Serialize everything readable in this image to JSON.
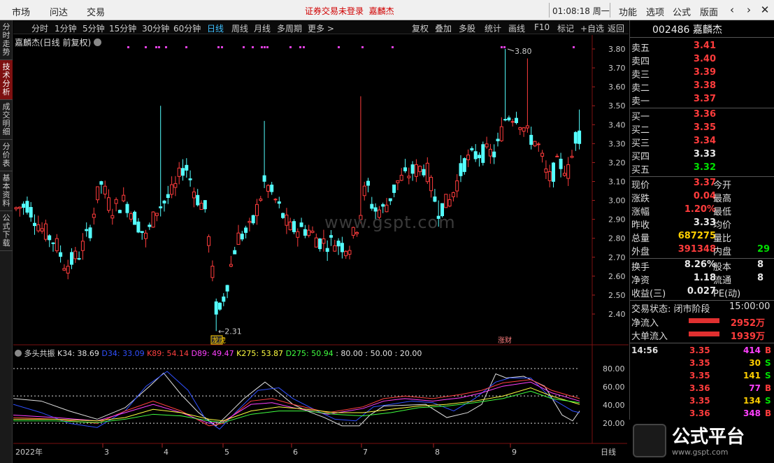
{
  "menu": {
    "market": "市场",
    "ask": "问达",
    "trade": "交易",
    "warning": "证券交易未登录",
    "stock": "嘉麟杰",
    "clock": "01:08:18 周一",
    "func": "功能",
    "option": "选项",
    "formula": "公式",
    "layout": "版面"
  },
  "left_tabs": [
    "分时走势",
    "技术分析",
    "成交明细",
    "分价表",
    "基本资料",
    "公式下载"
  ],
  "periods": [
    "分时",
    "1分钟",
    "5分钟",
    "15分钟",
    "30分钟",
    "60分钟",
    "日线",
    "周线",
    "月线",
    "多周期",
    "更多 >"
  ],
  "tools": [
    "复权",
    "叠加",
    "多股",
    "统计",
    "画线",
    "F10",
    "标记",
    "+自选",
    "返回"
  ],
  "chart_title": "嘉麟杰(日线 前复权)",
  "watermark": "www.gspt.com",
  "price_axis": [
    "3.80",
    "3.70",
    "3.60",
    "3.50",
    "3.40",
    "3.30",
    "3.20",
    "3.10",
    "3.00",
    "2.90",
    "2.80",
    "2.70",
    "2.60",
    "2.50",
    "2.40"
  ],
  "ind_axis": [
    "80.00",
    "60.00",
    "40.00",
    "20.00"
  ],
  "x_labels": [
    "2022年",
    "3",
    "4",
    "5",
    "6",
    "7",
    "8",
    "9"
  ],
  "period_badge": "日线",
  "annotations": {
    "high": "3.80",
    "low": "2.31",
    "tag1": "龙虎",
    "tag2": "涨财"
  },
  "indicator": {
    "name": "多头共振",
    "items": [
      "K34: 38.69",
      "D34: 33.09",
      "K89: 54.14",
      "D89: 49.47",
      "K275: 53.87",
      "D275: 50.94",
      ": 80.00",
      ": 50.00",
      ": 20.00"
    ],
    "colors": [
      "#e0e0e0",
      "#3050ff",
      "#ff4040",
      "#ff40ff",
      "#ffff40",
      "#40ff40",
      "#e0e0e0",
      "#e0e0e0",
      "#e0e0e0"
    ]
  },
  "chart_data": {
    "type": "candlestick",
    "symbol": "002486",
    "name": "嘉麟杰",
    "high": 3.8,
    "low": 2.31,
    "ylim": [
      2.31,
      3.82
    ],
    "ind_ylim": [
      0,
      100
    ]
  },
  "quote": {
    "code": "002486",
    "name": "嘉麟杰",
    "asks": [
      {
        "l": "卖五",
        "v": "3.41"
      },
      {
        "l": "卖四",
        "v": "3.40"
      },
      {
        "l": "卖三",
        "v": "3.39"
      },
      {
        "l": "卖二",
        "v": "3.38"
      },
      {
        "l": "卖一",
        "v": "3.37"
      }
    ],
    "bids": [
      {
        "l": "买一",
        "v": "3.36"
      },
      {
        "l": "买二",
        "v": "3.35"
      },
      {
        "l": "买三",
        "v": "3.34"
      },
      {
        "l": "买四",
        "v": "3.33"
      },
      {
        "l": "买五",
        "v": "3.32"
      }
    ],
    "stats": [
      {
        "l": "现价",
        "v": "3.37",
        "l2": "今开",
        "v2": ""
      },
      {
        "l": "涨跌",
        "v": "0.04",
        "l2": "最高",
        "v2": ""
      },
      {
        "l": "涨幅",
        "v": "1.20%",
        "l2": "最低",
        "v2": ""
      },
      {
        "l": "昨收",
        "v": "3.33",
        "l2": "均价",
        "v2": ""
      },
      {
        "l": "总量",
        "v": "687275",
        "l2": "量比",
        "v2": ""
      },
      {
        "l": "外盘",
        "v": "391348",
        "l2": "内盘",
        "v2": "29"
      }
    ],
    "stats2": [
      {
        "l": "换手",
        "v": "8.26%",
        "l2": "股本",
        "v2": "8"
      },
      {
        "l": "净资",
        "v": "1.18",
        "l2": "流通",
        "v2": "8"
      },
      {
        "l": "收益(三)",
        "v": "0.027",
        "l2": "PE(动)",
        "v2": ""
      }
    ],
    "status_label": "交易状态: 闭市阶段",
    "status_time": "15:00:00",
    "flow": [
      {
        "l": "净流入",
        "v": "2952万"
      },
      {
        "l": "大单流入",
        "v": "1939万"
      }
    ],
    "ticks": [
      {
        "t": "14:56",
        "p": "3.35",
        "q": "414",
        "d": "B"
      },
      {
        "t": "",
        "p": "3.35",
        "q": "30",
        "d": "S"
      },
      {
        "t": "",
        "p": "3.35",
        "q": "141",
        "d": "S"
      },
      {
        "t": "",
        "p": "3.36",
        "q": "77",
        "d": "B"
      },
      {
        "t": "",
        "p": "3.35",
        "q": "134",
        "d": "S"
      },
      {
        "t": "",
        "p": "3.36",
        "q": "348",
        "d": "B"
      }
    ]
  },
  "logo": {
    "text": "公式平台",
    "sub": "www.gspt.com"
  }
}
